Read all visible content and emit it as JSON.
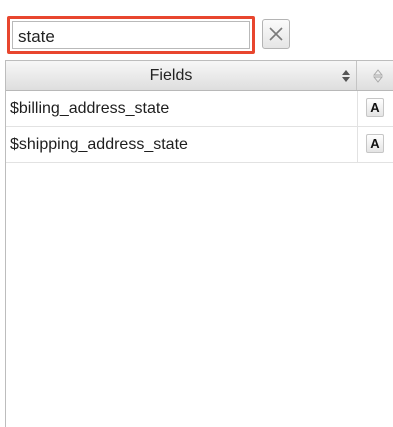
{
  "search": {
    "value": "state"
  },
  "table": {
    "header": {
      "fields_label": "Fields"
    },
    "rows": [
      {
        "field": "$billing_address_state",
        "type": "A"
      },
      {
        "field": "$shipping_address_state",
        "type": "A"
      }
    ]
  },
  "colors": {
    "highlight": "#e8462e"
  }
}
